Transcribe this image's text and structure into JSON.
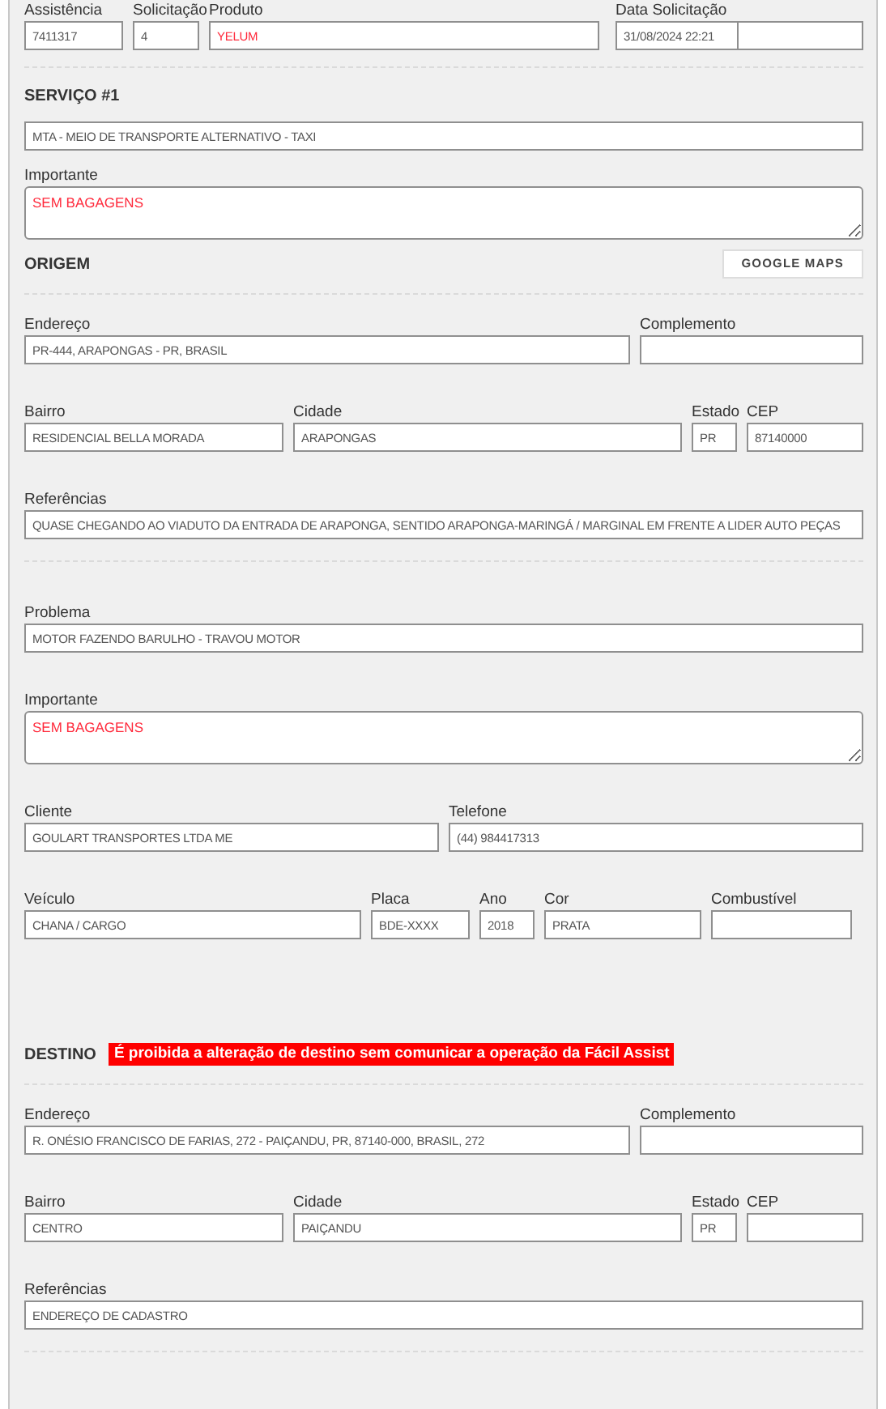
{
  "header_fields": [
    {
      "label": "Assistência",
      "value": "7411317",
      "emphasis": false
    },
    {
      "label": "Solicitação",
      "value": "4",
      "emphasis": false
    },
    {
      "label": "Produto",
      "value": "YELUM",
      "emphasis": true
    },
    {
      "label": "Data Solicitação",
      "value": "31/08/2024 22:21",
      "emphasis": false
    }
  ],
  "sections": [
    {
      "title": "SERVIÇO #1",
      "rows": [
        {
          "fields": [
            {
              "kind": "input",
              "value": "MTA - MEIO DE TRANSPORTE ALTERNATIVO - TAXI",
              "emphasis": false
            }
          ]
        },
        {
          "fields": [
            {
              "kind": "textarea",
              "label": "Importante",
              "value": "SEM BAGAGENS",
              "emphasis": true
            }
          ]
        }
      ]
    },
    {
      "title": "ORIGEM",
      "button": "GOOGLE MAPS",
      "rows": [
        {
          "fields": [
            {
              "kind": "input",
              "label": "Endereço",
              "value": "PR-444, ARAPONGAS - PR, BRASIL",
              "emphasis": false
            },
            {
              "kind": "input",
              "label": "Complemento"
            }
          ]
        },
        {
          "fields": [
            {
              "kind": "input",
              "label": "Bairro",
              "value": "RESIDENCIAL BELLA MORADA",
              "emphasis": false
            },
            {
              "kind": "input",
              "label": "Cidade",
              "value": "ARAPONGAS",
              "emphasis": false
            },
            {
              "kind": "input",
              "label": "Estado",
              "value": "PR",
              "emphasis": false
            },
            {
              "kind": "input",
              "label": "CEP",
              "value": "87140000",
              "emphasis": false
            }
          ]
        },
        {
          "fields": [
            {
              "kind": "input",
              "label": "Referências",
              "value": "QUASE CHEGANDO AO VIADUTO DA ENTRADA DE ARAPONGA, SENTIDO ARAPONGA-MARINGÁ / MARGINAL EM FRENTE A LIDER AUTO PEÇAS",
              "emphasis": false
            }
          ]
        }
      ]
    },
    {
      "rows": [
        {
          "fields": [
            {
              "kind": "input",
              "label": "Problema",
              "value": "MOTOR FAZENDO BARULHO - TRAVOU MOTOR",
              "emphasis": false
            }
          ]
        },
        {
          "fields": [
            {
              "kind": "textarea",
              "label": "Importante",
              "value": "SEM BAGAGENS",
              "emphasis": true
            }
          ]
        },
        {
          "fields": [
            {
              "kind": "input",
              "label": "Cliente",
              "value": "GOULART TRANSPORTES LTDA ME",
              "emphasis": false
            },
            {
              "kind": "input",
              "label": "Telefone",
              "value": "(44) 984417313",
              "emphasis": false
            }
          ]
        },
        {
          "fields": [
            {
              "kind": "input",
              "label": "Veículo",
              "value": "CHANA / CARGO",
              "emphasis": false
            },
            {
              "kind": "input",
              "label": "Placa",
              "value": "BDE-XXXX",
              "emphasis": false
            },
            {
              "kind": "input",
              "label": "Ano",
              "value": "2018",
              "emphasis": false
            },
            {
              "kind": "input",
              "label": "Cor",
              "value": "PRATA",
              "emphasis": false
            },
            {
              "kind": "input",
              "label": "Combustível"
            }
          ]
        }
      ]
    },
    {
      "title": "DESTINO",
      "warning": "É proibida a alteração de destino sem comunicar a operação da Fácil Assist",
      "rows": [
        {
          "fields": [
            {
              "kind": "input",
              "label": "Endereço",
              "value": "R. ONÉSIO FRANCISCO DE FARIAS, 272 - PAIÇANDU, PR, 87140-000, BRASIL, 272",
              "emphasis": false
            },
            {
              "kind": "input",
              "label": "Complemento"
            }
          ]
        },
        {
          "fields": [
            {
              "kind": "input",
              "label": "Bairro",
              "value": "CENTRO",
              "emphasis": false
            },
            {
              "kind": "input",
              "label": "Cidade",
              "value": "PAIÇANDU",
              "emphasis": false
            },
            {
              "kind": "input",
              "label": "Estado",
              "value": "PR",
              "emphasis": false
            },
            {
              "kind": "input",
              "label": "CEP"
            }
          ]
        },
        {
          "fields": [
            {
              "kind": "input",
              "label": "Referências",
              "value": "ENDEREÇO DE CADASTRO",
              "emphasis": false
            }
          ]
        }
      ]
    }
  ]
}
